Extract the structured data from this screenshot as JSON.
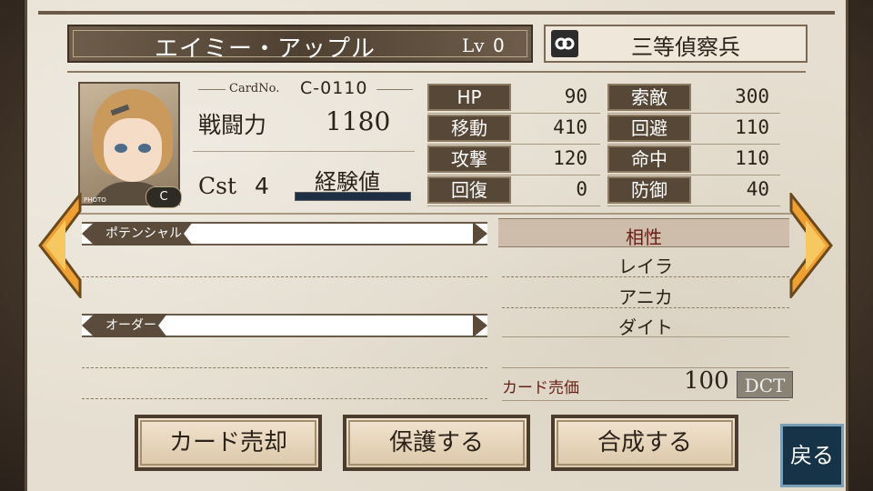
{
  "character": {
    "name": "エイミー・アップル",
    "lv_label": "Lv",
    "lv_value": "0",
    "rank": "三等偵察兵",
    "card_no_label": "CardNo.",
    "card_no": "C-0110",
    "power_label": "戦闘力",
    "power_value": "1180",
    "cst_label": "Cst",
    "cst_value": "4",
    "exp_label": "経験値",
    "exp_fill": 0,
    "photo_tag": "PHOTO",
    "class_badge": "C"
  },
  "stats": [
    {
      "label": "HP",
      "value": "90"
    },
    {
      "label": "索敵",
      "value": "300"
    },
    {
      "label": "移動",
      "value": "410"
    },
    {
      "label": "回避",
      "value": "110"
    },
    {
      "label": "攻撃",
      "value": "120"
    },
    {
      "label": "命中",
      "value": "110"
    },
    {
      "label": "回復",
      "value": "0"
    },
    {
      "label": "防御",
      "value": "40"
    }
  ],
  "sections": {
    "potential": "ポテンシャル",
    "order": "オーダー"
  },
  "affinity": {
    "title": "相性",
    "items": [
      "レイラ",
      "アニカ",
      "ダイト"
    ]
  },
  "price": {
    "label": "カード売価",
    "value": "100",
    "unit": "DCT"
  },
  "buttons": {
    "sell": "カード売却",
    "protect": "保護する",
    "synth": "合成する",
    "back": "戻る"
  },
  "icons": {
    "rank": "rank-insignia-icon",
    "left": "arrow-left-icon",
    "right": "arrow-right-icon"
  },
  "colors": {
    "panel": "#e6dfd1",
    "dark_plate": "#574737",
    "accent_red": "#6a1d14",
    "arrow_orange": "#f0a030",
    "back_button": "#173347"
  }
}
